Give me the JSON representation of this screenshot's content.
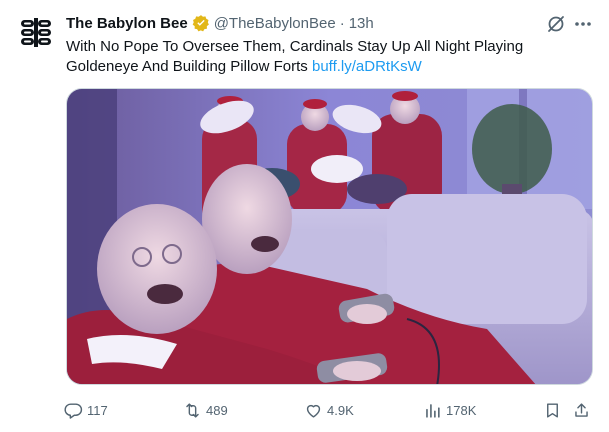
{
  "tweet": {
    "author_name": "The Babylon Bee",
    "handle": "@TheBabylonBee",
    "separator": "·",
    "time": "13h",
    "text": "With No Pope To Oversee Them, Cardinals Stay Up All Night Playing Goldeneye And Building Pillow Forts ",
    "link": "buff.ly/aDRtKsW"
  },
  "actions": {
    "reply_count": "117",
    "retweet_count": "489",
    "like_count": "4.9K",
    "view_count": "178K"
  },
  "icons": {
    "avatar": "babylon-bee-logo",
    "verified": "verified-gold-badge",
    "grok": "grok-icon",
    "more": "more-dots-icon",
    "reply": "reply-icon",
    "retweet": "retweet-icon",
    "like": "heart-icon",
    "views": "views-bar-icon",
    "bookmark": "bookmark-icon",
    "share": "share-icon"
  },
  "colors": {
    "link": "#1d9bf0",
    "verified": "#e2b719",
    "secondary_text": "#536471"
  }
}
